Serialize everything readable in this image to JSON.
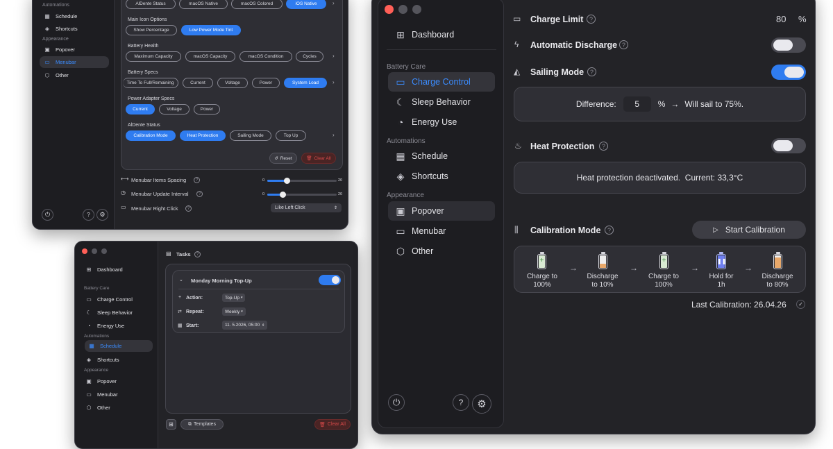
{
  "win1": {
    "sidebar": {
      "section_automations": "Automations",
      "schedule": "Schedule",
      "shortcuts": "Shortcuts",
      "section_appearance": "Appearance",
      "popover": "Popover",
      "menubar": "Menubar",
      "other": "Other"
    },
    "style_chips": [
      "AlDente Status",
      "macOS Native",
      "macOS Colored",
      "iOS Native"
    ],
    "main_icon_label": "Main Icon Options",
    "main_icon_chips": [
      "Show Percentage",
      "Low Power Mode Tint"
    ],
    "battery_health_label": "Battery Health",
    "battery_health_chips": [
      "Maximum Capacity",
      "macOS Capacity",
      "macOS Condition",
      "Cycles"
    ],
    "battery_specs_label": "Battery Specs",
    "battery_specs_chips": [
      "Time To Full/Remaining",
      "Current",
      "Voltage",
      "Power",
      "System Load"
    ],
    "power_adapter_label": "Power Adapter Specs",
    "power_adapter_chips": [
      "Current",
      "Voltage",
      "Power"
    ],
    "aldente_status_label": "AlDente Status",
    "aldente_status_chips": [
      "Calibration Mode",
      "Heat Protection",
      "Sailing Mode",
      "Top Up"
    ],
    "reset": "Reset",
    "clear_all": "Clear All",
    "spacing_label": "Menubar Items Spacing",
    "spacing_min": "0",
    "spacing_max": "20",
    "spacing_value": 0.28,
    "interval_label": "Menubar Update Interval",
    "interval_min": "0",
    "interval_max": "20",
    "interval_value": 0.22,
    "right_click_label": "Menubar Right Click",
    "right_click_value": "Like Left Click"
  },
  "win2": {
    "sidebar": {
      "dashboard": "Dashboard",
      "section_battery": "Battery Care",
      "charge_control": "Charge Control",
      "sleep_behavior": "Sleep Behavior",
      "energy_use": "Energy Use",
      "section_automations": "Automations",
      "schedule": "Schedule",
      "shortcuts": "Shortcuts",
      "section_appearance": "Appearance",
      "popover": "Popover",
      "menubar": "Menubar",
      "other": "Other"
    },
    "header": "Tasks",
    "task_title": "Monday Morning Top-Up",
    "action_label": "Action:",
    "action_value": "Top-Up",
    "repeat_label": "Repeat:",
    "repeat_value": "Weekly",
    "start_label": "Start:",
    "start_value": "11. 5.2026, 05:00",
    "templates": "Templates",
    "clear_all": "Clear All"
  },
  "win3": {
    "sidebar": {
      "dashboard": "Dashboard",
      "section_battery": "Battery Care",
      "charge_control": "Charge Control",
      "sleep_behavior": "Sleep Behavior",
      "energy_use": "Energy Use",
      "section_automations": "Automations",
      "schedule": "Schedule",
      "shortcuts": "Shortcuts",
      "section_appearance": "Appearance",
      "popover": "Popover",
      "menubar": "Menubar",
      "other": "Other"
    },
    "charge_limit_label": "Charge Limit",
    "charge_limit_value": "80",
    "charge_limit_unit": "%",
    "auto_discharge_label": "Automatic Discharge",
    "sailing_label": "Sailing Mode",
    "difference_label": "Difference:",
    "difference_value": "5",
    "difference_unit": "%",
    "sail_text": "Will sail to 75%.",
    "heat_label": "Heat Protection",
    "heat_text": "Heat protection deactivated.  Current: 33,3°C",
    "calibration_label": "Calibration Mode",
    "start_calibration": "Start Calibration",
    "steps": [
      {
        "l1": "Charge to",
        "l2": "100%"
      },
      {
        "l1": "Discharge",
        "l2": "to 10%"
      },
      {
        "l1": "Charge to",
        "l2": "100%"
      },
      {
        "l1": "Hold for",
        "l2": "1h"
      },
      {
        "l1": "Discharge",
        "l2": "to 80%"
      }
    ],
    "last_calibration": "Last Calibration: 26.04.26"
  },
  "colors": {
    "accent": "#2f7cf0",
    "close": "#ff5f57"
  }
}
